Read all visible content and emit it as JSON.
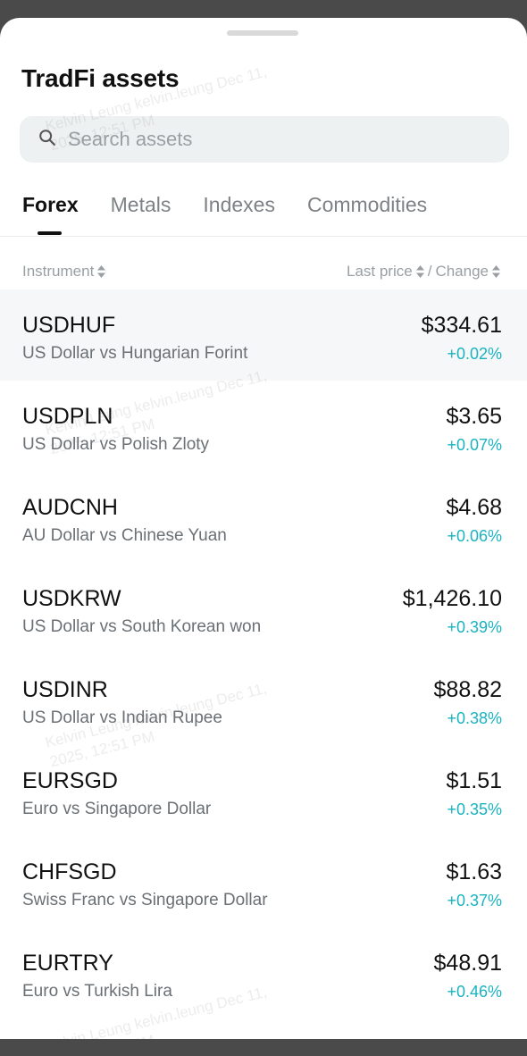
{
  "sheet": {
    "title": "TradFi assets"
  },
  "search": {
    "placeholder": "Search assets",
    "value": ""
  },
  "tabs": [
    {
      "label": "Forex",
      "active": true
    },
    {
      "label": "Metals",
      "active": false
    },
    {
      "label": "Indexes",
      "active": false
    },
    {
      "label": "Commodities",
      "active": false
    }
  ],
  "columns": {
    "instrument": "Instrument",
    "last_price": "Last price",
    "separator": "/",
    "change": "Change"
  },
  "rows": [
    {
      "symbol": "USDHUF",
      "name": "US Dollar vs Hungarian Forint",
      "price": "$334.61",
      "change": "+0.02%"
    },
    {
      "symbol": "USDPLN",
      "name": "US Dollar vs Polish Zloty",
      "price": "$3.65",
      "change": "+0.07%"
    },
    {
      "symbol": "AUDCNH",
      "name": "AU Dollar vs Chinese Yuan",
      "price": "$4.68",
      "change": "+0.06%"
    },
    {
      "symbol": "USDKRW",
      "name": "US Dollar vs South Korean won",
      "price": "$1,426.10",
      "change": "+0.39%"
    },
    {
      "symbol": "USDINR",
      "name": "US Dollar vs Indian Rupee",
      "price": "$88.82",
      "change": "+0.38%"
    },
    {
      "symbol": "EURSGD",
      "name": "Euro vs Singapore Dollar",
      "price": "$1.51",
      "change": "+0.35%"
    },
    {
      "symbol": "CHFSGD",
      "name": "Swiss Franc vs Singapore Dollar",
      "price": "$1.63",
      "change": "+0.37%"
    },
    {
      "symbol": "EURTRY",
      "name": "Euro vs Turkish Lira",
      "price": "$48.91",
      "change": "+0.46%"
    }
  ],
  "watermark": {
    "line1": "Kelvin Leung kelvin.leung Dec 11,",
    "line2": "2025, 12:51 PM"
  },
  "colors": {
    "positive": "#19b3c0",
    "text": "#111111",
    "muted": "#6b7075"
  },
  "icons": {
    "search": "search-icon",
    "sort": "sort-arrows-icon"
  }
}
